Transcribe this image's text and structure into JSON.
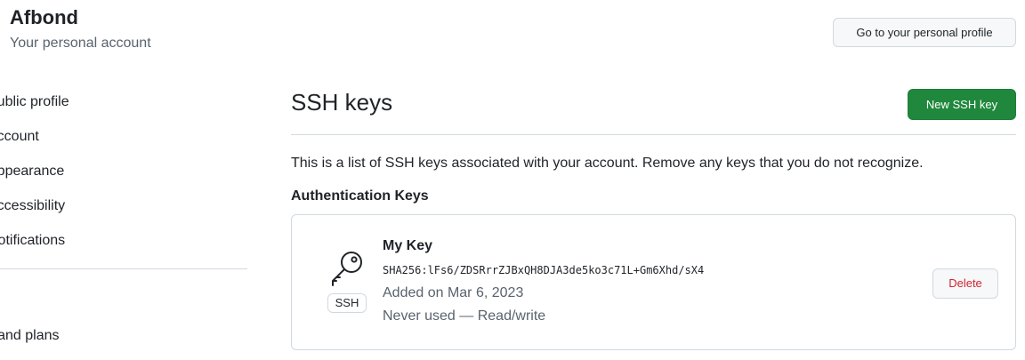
{
  "account": {
    "name": "Afbond",
    "subtitle": "Your personal account",
    "profile_button": "Go to your personal profile"
  },
  "sidebar": {
    "items": [
      {
        "label": "Public profile",
        "icon": "person-icon"
      },
      {
        "label": "Account",
        "icon": "gear-icon"
      },
      {
        "label": "Appearance",
        "icon": "paintbrush-icon"
      },
      {
        "label": "Accessibility",
        "icon": "accessibility-icon"
      },
      {
        "label": "Notifications",
        "icon": "bell-icon"
      }
    ],
    "bottom_item": {
      "label": "Billing and plans",
      "icon": "credit-card-icon"
    }
  },
  "main": {
    "title": "SSH keys",
    "new_button": "New SSH key",
    "description": "This is a list of SSH keys associated with your account. Remove any keys that you do not recognize.",
    "section_heading": "Authentication Keys",
    "keys": [
      {
        "name": "My Key",
        "fingerprint": "SHA256:lFs6/ZDSRrrZJBxQH8DJA3de5ko3c71L+Gm6Xhd/sX4",
        "added": "Added on Mar 6, 2023",
        "usage": "Never used — Read/write",
        "badge": "SSH",
        "icon": "key-icon",
        "delete_label": "Delete"
      }
    ]
  },
  "colors": {
    "accent_green": "#1f883d",
    "danger_red": "#d1242f",
    "muted_text": "#59636e",
    "border": "#d1d9e0"
  }
}
